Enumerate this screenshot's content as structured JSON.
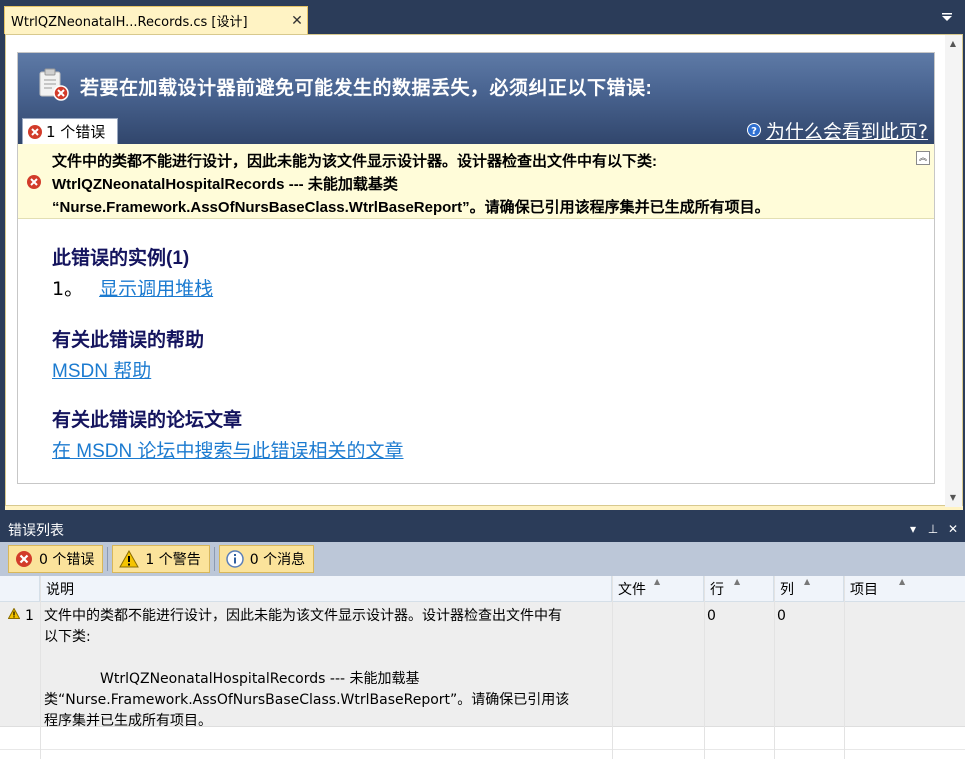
{
  "document_tab": {
    "label": "WtrlQZNeonatalH...Records.cs [设计]",
    "close_glyph": "✕"
  },
  "error_panel": {
    "header_title": "若要在加载设计器前避免可能发生的数据丢失，必须纠正以下错误:",
    "error_count_tab": "1 个错误",
    "why_link": "为什么会看到此页?",
    "message_lines": [
      "文件中的类都不能进行设计，因此未能为该文件显示设计器。设计器检查出文件中有以下类:",
      "WtrlQZNeonatalHospitalRecords --- 未能加载基类",
      "“Nurse.Framework.AssOfNursBaseClass.WtrlBaseReport”。请确保已引用该程序集并已生成所有项目。"
    ],
    "instances_title": "此错误的实例(1)",
    "instance_number": "1。",
    "instance_link": "显示调用堆栈",
    "help_title": "有关此错误的帮助",
    "help_link": "MSDN 帮助",
    "forum_title": "有关此错误的论坛文章",
    "forum_link": "在 MSDN 论坛中搜索与此错误相关的文章"
  },
  "error_list": {
    "title": "错误列表",
    "filters": {
      "errors": "0 个错误",
      "warnings": "1 个警告",
      "messages": "0 个消息"
    },
    "columns": {
      "description": "说明",
      "file": "文件",
      "line": "行",
      "column": "列",
      "project": "项目"
    },
    "rows": [
      {
        "number": "1",
        "description_lines": [
          "文件中的类都不能进行设计，因此未能为该文件显示设计器。设计器检查出文件中有",
          "以下类:",
          "",
          "WtrlQZNeonatalHospitalRecords --- 未能加载基",
          "类“Nurse.Framework.AssOfNursBaseClass.WtrlBaseReport”。请确保已引用该",
          "程序集并已生成所有项目。"
        ],
        "line": "0",
        "column": "0"
      }
    ]
  },
  "colors": {
    "chrome_dark": "#2b3c59",
    "tab_gold": "#fff3c4",
    "header_blue": "#4a6592",
    "link_blue": "#1c7bd0",
    "title_navy": "#14145e",
    "error_red": "#d23b2a",
    "warning_yellow": "#f5c400"
  }
}
